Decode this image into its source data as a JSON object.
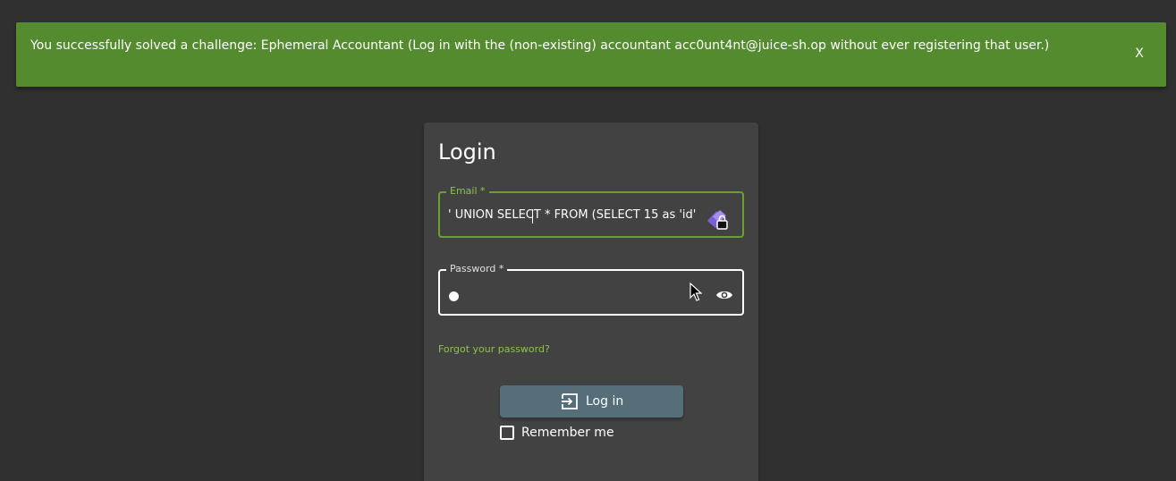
{
  "banner": {
    "message": "You successfully solved a challenge: Ephemeral Accountant (Log in with the (non-existing) accountant acc0unt4nt@juice-sh.op without ever registering that user.)",
    "close_label": "X",
    "color": "#558b2f"
  },
  "login": {
    "title": "Login",
    "email": {
      "label": "Email *",
      "value": "' UNION SELECT * FROM (SELECT 15 as 'id'"
    },
    "password": {
      "label": "Password *",
      "toggle_icon": "eye-icon"
    },
    "password_manager_icon": "lock-badge-icon",
    "forgot_password": "Forgot your password?",
    "submit_label": "Log in",
    "submit_icon": "login-icon",
    "remember_me": "Remember me",
    "remember_checked": false
  },
  "colors": {
    "background": "#303030",
    "card": "#424242",
    "accent": "#8bc34a",
    "button": "#546e7a"
  }
}
